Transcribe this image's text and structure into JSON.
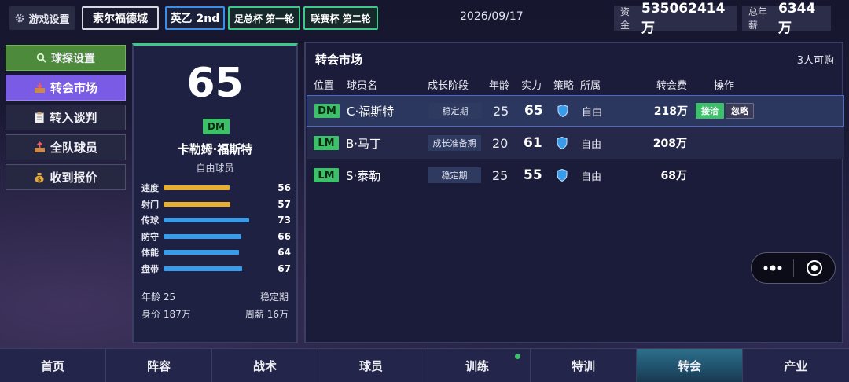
{
  "topbar": {
    "settings_label": "游戏设置",
    "club_name": "索尔福德城",
    "league": "英乙 2nd",
    "cup1": "足总杯 第一轮",
    "cup2": "联赛杯 第二轮",
    "date": "2026/09/17",
    "funds_label": "资金",
    "funds_value": "535062414万",
    "wage_label": "总年薪",
    "wage_value": "6344万"
  },
  "menu": {
    "scout": "球探设置",
    "market": "转会市场",
    "negotiate": "转入谈判",
    "squad": "全队球员",
    "offers": "收到报价"
  },
  "card": {
    "rating": "65",
    "position": "DM",
    "name": "卡勒姆·福斯特",
    "status": "自由球员",
    "attributes": [
      {
        "label": "速度",
        "value": 56,
        "color": "#e8b030"
      },
      {
        "label": "射门",
        "value": 57,
        "color": "#e8b030"
      },
      {
        "label": "传球",
        "value": 73,
        "color": "#3a9be8"
      },
      {
        "label": "防守",
        "value": 66,
        "color": "#3a9be8"
      },
      {
        "label": "体能",
        "value": 64,
        "color": "#3a9be8"
      },
      {
        "label": "盘带",
        "value": 67,
        "color": "#3a9be8"
      }
    ],
    "age_text": "年龄 25",
    "stage_text": "稳定期",
    "value_text": "身价 187万",
    "wage_text": "周薪 16万"
  },
  "market": {
    "title": "转会市场",
    "count": "3人可购",
    "headers": {
      "pos": "位置",
      "name": "球员名",
      "stage": "成长阶段",
      "age": "年龄",
      "power": "实力",
      "tactic": "策略",
      "club": "所属",
      "fee": "转会费",
      "action": "操作"
    },
    "rows": [
      {
        "pos": "DM",
        "name": "C·福斯特",
        "stage": "稳定期",
        "age": "25",
        "power": "65",
        "club": "自由",
        "fee": "218万",
        "accept": "接洽",
        "ignore": "忽略"
      },
      {
        "pos": "LM",
        "name": "B·马丁",
        "stage": "成长准备期",
        "age": "20",
        "power": "61",
        "club": "自由",
        "fee": "208万"
      },
      {
        "pos": "LM",
        "name": "S·泰勒",
        "stage": "稳定期",
        "age": "25",
        "power": "55",
        "club": "自由",
        "fee": "68万"
      }
    ]
  },
  "bottomnav": [
    "首页",
    "阵容",
    "战术",
    "球员",
    "训练",
    "特训",
    "转会",
    "产业"
  ],
  "colors": {
    "accent": "#3ec06a",
    "active_menu": "#7a5be6",
    "shield": "#3a9be8"
  }
}
